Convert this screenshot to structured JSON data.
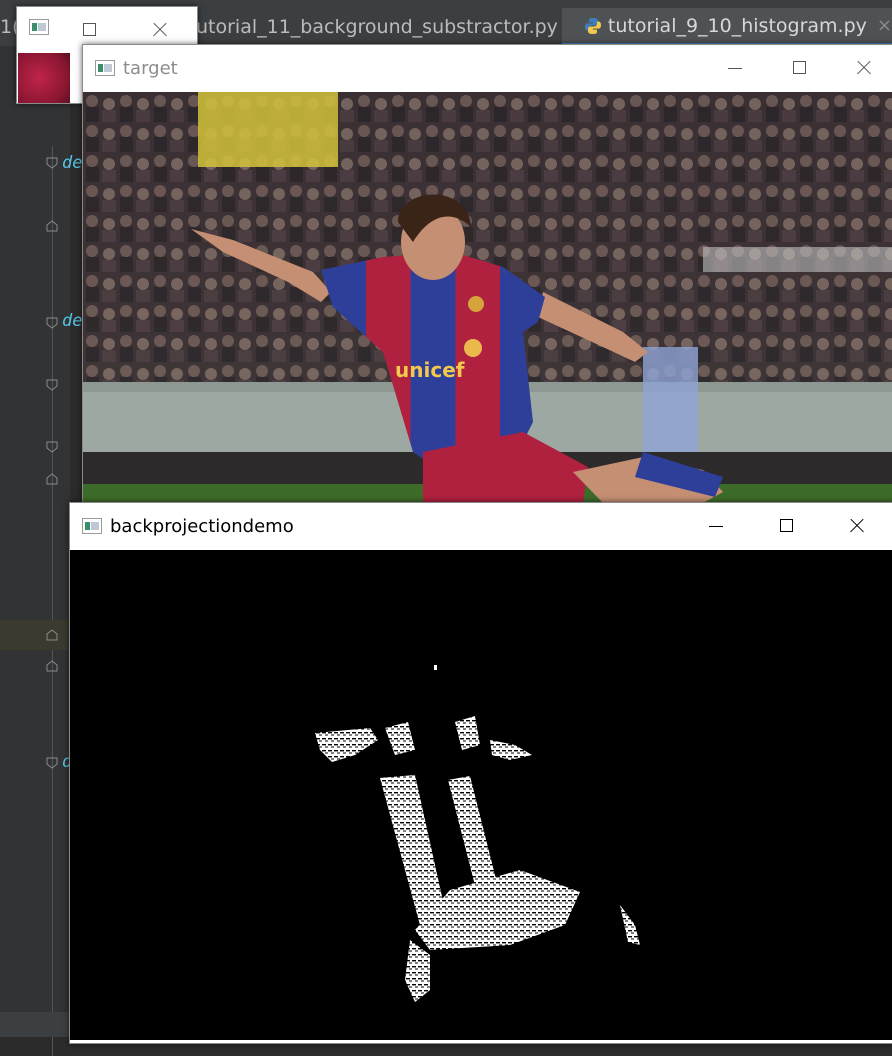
{
  "ide": {
    "tabs": [
      {
        "label": "1(",
        "active": false
      },
      {
        "label": "utorial_11_background_substractor.py",
        "active": false,
        "close": "×"
      },
      {
        "label": "tutorial_9_10_histogram.py",
        "active": true,
        "close": "×"
      }
    ],
    "code_fragments": [
      "de",
      "de",
      "d"
    ]
  },
  "windows": {
    "small": {
      "title": ""
    },
    "target": {
      "title": "target"
    },
    "backprojection": {
      "title": "backprojectiondemo"
    }
  },
  "colors": {
    "ide_bg": "#2b2b2b",
    "tab_active_underline": "#4a88c7",
    "code_keyword": "#56c4e6",
    "jersey_red": "#b0213f",
    "jersey_blue": "#2e3f9a",
    "sponsor_text": "#f2c94c"
  },
  "photo": {
    "sponsor_text": "unicef"
  }
}
